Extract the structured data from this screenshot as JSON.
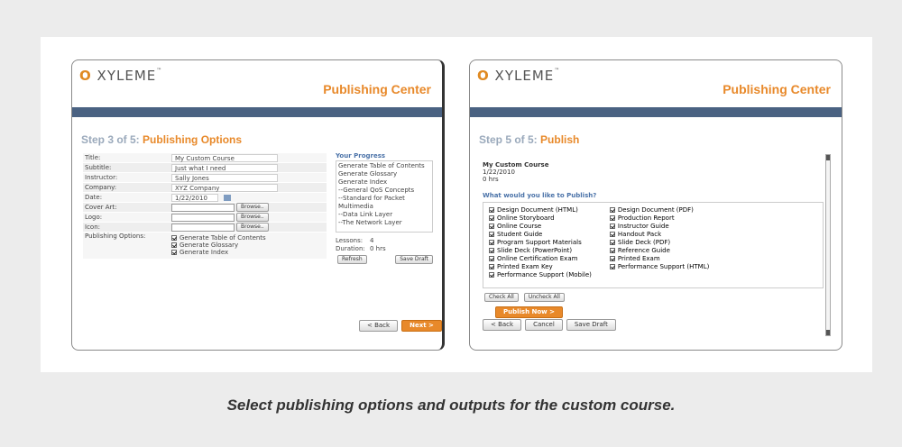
{
  "left": {
    "logo": "XYLEME",
    "title": "Publishing Center",
    "step_prefix": "Step 3 of 5:",
    "step_name": "Publishing Options",
    "fields": [
      {
        "label": "Title:",
        "value": "My Custom Course"
      },
      {
        "label": "Subtitle:",
        "value": "Just what I need"
      },
      {
        "label": "Instructor:",
        "value": "Sally Jones"
      },
      {
        "label": "Company:",
        "value": "XYZ Company"
      },
      {
        "label": "Date:",
        "value": "1/22/2010"
      },
      {
        "label": "Cover Art:",
        "value": ""
      },
      {
        "label": "Logo:",
        "value": ""
      },
      {
        "label": "Icon:",
        "value": ""
      },
      {
        "label": "Publishing Options:",
        "value": ""
      }
    ],
    "browse": "Browse..",
    "options": [
      "Generate Table of Contents",
      "Generate Glossary",
      "Generate Index"
    ],
    "progress_heading": "Your Progress",
    "progress_items": [
      "Generate Table of Contents",
      "Generate Glossary",
      "Generate Index",
      "--General QoS Concepts",
      "--Standard for Packet Multimedia",
      "--Data Link Layer",
      "--The Network Layer"
    ],
    "lessons_label": "Lessons:",
    "lessons": "4",
    "duration_label": "Duration:",
    "duration": "0 hrs",
    "refresh": "Refresh",
    "save_draft": "Save Draft",
    "back": "< Back",
    "next": "Next >"
  },
  "right": {
    "logo": "XYLEME",
    "title": "Publishing Center",
    "step_prefix": "Step 5 of 5:",
    "step_name": "Publish",
    "course": "My Custom Course",
    "date": "1/22/2010",
    "hours": "0 hrs",
    "question": "What would you like to Publish?",
    "col1": [
      "Design Document (HTML)",
      "Online Storyboard",
      "Online Course",
      "Student Guide",
      "Program Support Materials",
      "Slide Deck (PowerPoint)",
      "Online Certification Exam",
      "Printed Exam Key",
      "Performance Support (Mobile)"
    ],
    "col2": [
      "Design Document (PDF)",
      "Production Report",
      "Instructor Guide",
      "Handout Pack",
      "Slide Deck (PDF)",
      "Reference Guide",
      "Printed Exam",
      "Performance Support (HTML)"
    ],
    "check_all": "Check All",
    "uncheck_all": "Uncheck All",
    "publish_now": "Publish Now >",
    "back": "< Back",
    "cancel": "Cancel",
    "save_draft": "Save Draft"
  },
  "caption": "Select publishing options and outputs for the custom course.",
  "colors": {
    "accent": "#e8892a",
    "bar": "#4a6282",
    "link": "#4a72a8"
  }
}
